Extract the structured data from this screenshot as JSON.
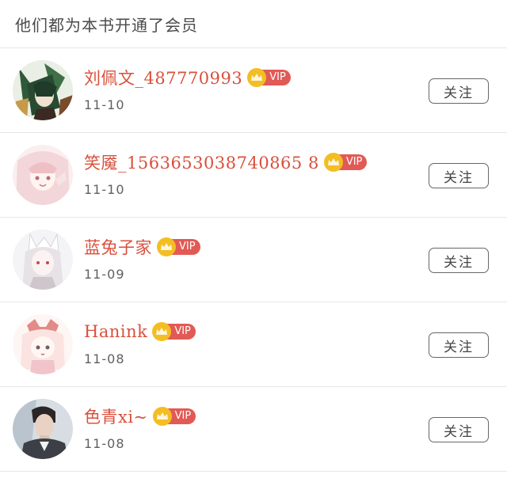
{
  "header": {
    "title": "他们都为本书开通了会员"
  },
  "members": [
    {
      "name": "刘佩文_487770993",
      "vip_label": "VIP",
      "date": "11-10",
      "follow_label": "关注",
      "avatar": "avatar-green-hair-character"
    },
    {
      "name": "笑魇_1563653038740865 8",
      "vip_label": "VIP",
      "date": "11-10",
      "follow_label": "关注",
      "avatar": "avatar-pink-anime-girl"
    },
    {
      "name": "蓝兔子家",
      "vip_label": "VIP",
      "date": "11-09",
      "follow_label": "关注",
      "avatar": "avatar-fox-mask-girl"
    },
    {
      "name": "Hanink",
      "vip_label": "VIP",
      "date": "11-08",
      "follow_label": "关注",
      "avatar": "avatar-chibi-pink-girl"
    },
    {
      "name": "色青xi~",
      "vip_label": "VIP",
      "date": "11-08",
      "follow_label": "关注",
      "avatar": "avatar-man-portrait"
    }
  ],
  "colors": {
    "name": "#d9503c",
    "vip_badge": "#e25a55",
    "crown": "#f3be24",
    "divider": "#e6e6e6"
  },
  "icons": {
    "vip": "crown-icon"
  }
}
